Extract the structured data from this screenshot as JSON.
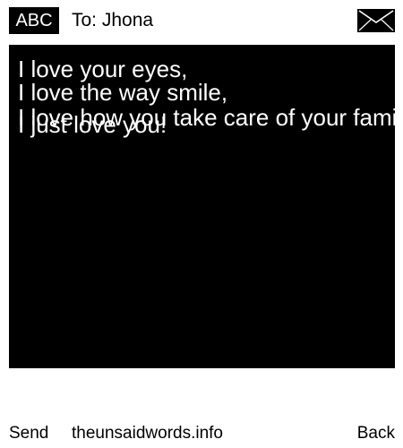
{
  "header": {
    "badge": "ABC",
    "to_line": "To: Jhona",
    "send_icon": "envelope-icon"
  },
  "message": {
    "lines": [
      "I love your eyes,",
      "I love the way smile,",
      "I love how you take care of your family.",
      "I just love you!"
    ]
  },
  "footer": {
    "send_label": "Send",
    "site": "theunsaidwords.info",
    "back_label": "Back"
  },
  "colors": {
    "background": "#ffffff",
    "panel": "#000000",
    "text_on_panel": "#ffffff"
  }
}
